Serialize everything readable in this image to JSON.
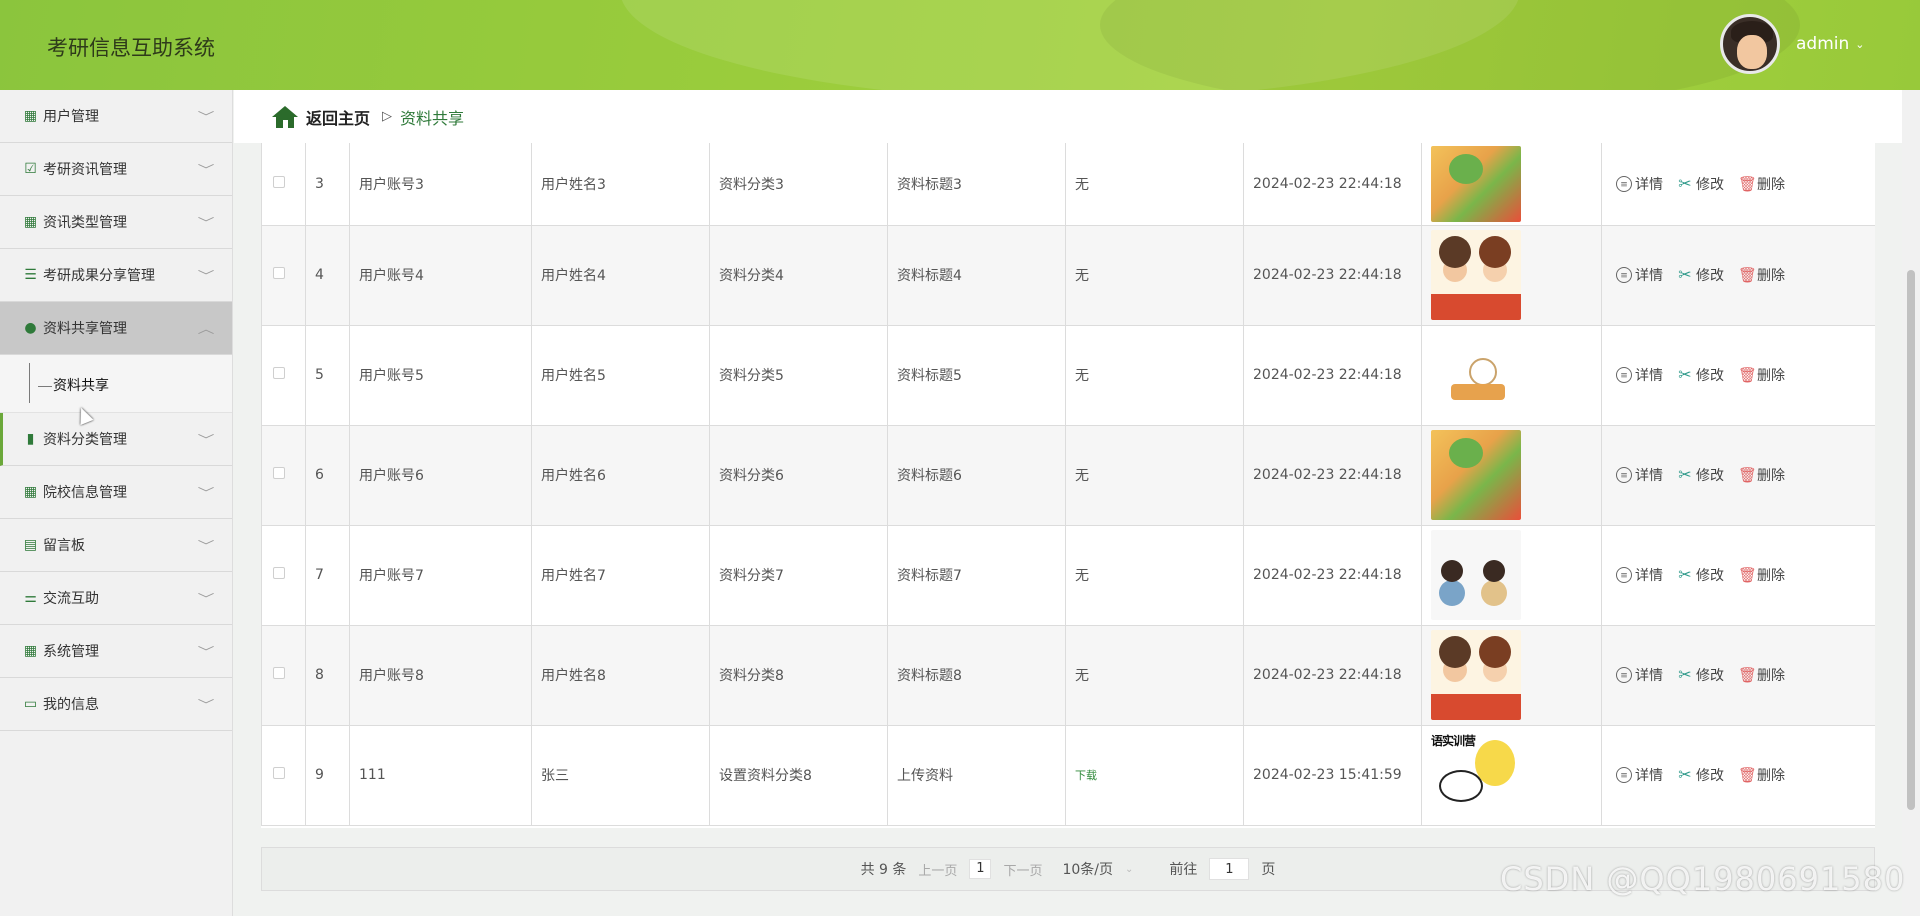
{
  "header": {
    "app_title": "考研信息互助系统",
    "username": "admin",
    "caret": "⌄"
  },
  "sidebar": {
    "items": [
      {
        "label": "用户管理",
        "icon": "grid-icon",
        "glyph": "▦"
      },
      {
        "label": "考研资讯管理",
        "icon": "clipboard-check-icon",
        "glyph": "☑"
      },
      {
        "label": "资讯类型管理",
        "icon": "grid-icon",
        "glyph": "▦"
      },
      {
        "label": "考研成果分享管理",
        "icon": "list-icon",
        "glyph": "☰"
      },
      {
        "label": "资料共享管理",
        "icon": "user-icon",
        "glyph": "●"
      },
      {
        "label": "资料分类管理",
        "icon": "bar-chart-icon",
        "glyph": "▮"
      },
      {
        "label": "院校信息管理",
        "icon": "grid-icon",
        "glyph": "▦"
      },
      {
        "label": "留言板",
        "icon": "briefcase-icon",
        "glyph": "▤"
      },
      {
        "label": "交流互助",
        "icon": "sliders-icon",
        "glyph": "⚌"
      },
      {
        "label": "系统管理",
        "icon": "grid-icon",
        "glyph": "▦"
      },
      {
        "label": "我的信息",
        "icon": "card-icon",
        "glyph": "▭"
      }
    ],
    "submenu": {
      "label": "资料共享"
    }
  },
  "breadcrumb": {
    "home": "返回主页",
    "separator": "▷",
    "current": "资料共享"
  },
  "table": {
    "rows": [
      {
        "index": "3",
        "account": "用户账号3",
        "name": "用户姓名3",
        "category": "资料分类3",
        "title": "资料标题3",
        "file": "无",
        "time": "2024-02-23 22:44:18",
        "thumb": "t1"
      },
      {
        "index": "4",
        "account": "用户账号4",
        "name": "用户姓名4",
        "category": "资料分类4",
        "title": "资料标题4",
        "file": "无",
        "time": "2024-02-23 22:44:18",
        "thumb": "t2"
      },
      {
        "index": "5",
        "account": "用户账号5",
        "name": "用户姓名5",
        "category": "资料分类5",
        "title": "资料标题5",
        "file": "无",
        "time": "2024-02-23 22:44:18",
        "thumb": "t3"
      },
      {
        "index": "6",
        "account": "用户账号6",
        "name": "用户姓名6",
        "category": "资料分类6",
        "title": "资料标题6",
        "file": "无",
        "time": "2024-02-23 22:44:18",
        "thumb": "t1"
      },
      {
        "index": "7",
        "account": "用户账号7",
        "name": "用户姓名7",
        "category": "资料分类7",
        "title": "资料标题7",
        "file": "无",
        "time": "2024-02-23 22:44:18",
        "thumb": "t4"
      },
      {
        "index": "8",
        "account": "用户账号8",
        "name": "用户姓名8",
        "category": "资料分类8",
        "title": "资料标题8",
        "file": "无",
        "time": "2024-02-23 22:44:18",
        "thumb": "t2"
      },
      {
        "index": "9",
        "account": "111",
        "name": "张三",
        "category": "设置资料分类8",
        "title": "上传资料",
        "file": "下载",
        "time": "2024-02-23 15:41:59",
        "thumb": "t5",
        "thumb_caption": "语实训营"
      }
    ],
    "ops": {
      "detail": "详情",
      "edit": "修改",
      "delete": "删除"
    }
  },
  "pagination": {
    "total": "共 9 条",
    "prev": "上一页",
    "current_page": "1",
    "next": "下一页",
    "page_size": "10条/页",
    "goto_label": "前往",
    "goto_value": "1",
    "goto_suffix": "页"
  },
  "watermark": "CSDN @QQ1980691580",
  "colors": {
    "header_green": "#9ccd3c",
    "accent_green": "#2f7a3a",
    "delete_red": "#e06464",
    "edit_teal": "#2f9a8a"
  }
}
